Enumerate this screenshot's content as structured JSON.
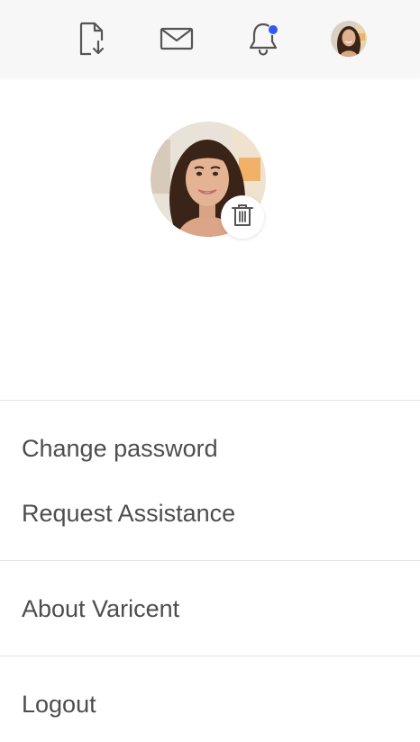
{
  "header": {
    "icons": {
      "export": "file-download-icon",
      "mail": "envelope-icon",
      "notifications": "bell-icon",
      "avatar": "user-avatar"
    },
    "notification_dot_color": "#2f5bf0"
  },
  "profile": {
    "delete_icon": "trash-icon"
  },
  "menu": {
    "change_password": "Change password",
    "request_assistance": "Request Assistance",
    "about": "About Varicent",
    "logout": "Logout"
  },
  "colors": {
    "text": "#4d4d4d",
    "topbar": "#f7f7f8",
    "divider": "#e2e2e2"
  }
}
